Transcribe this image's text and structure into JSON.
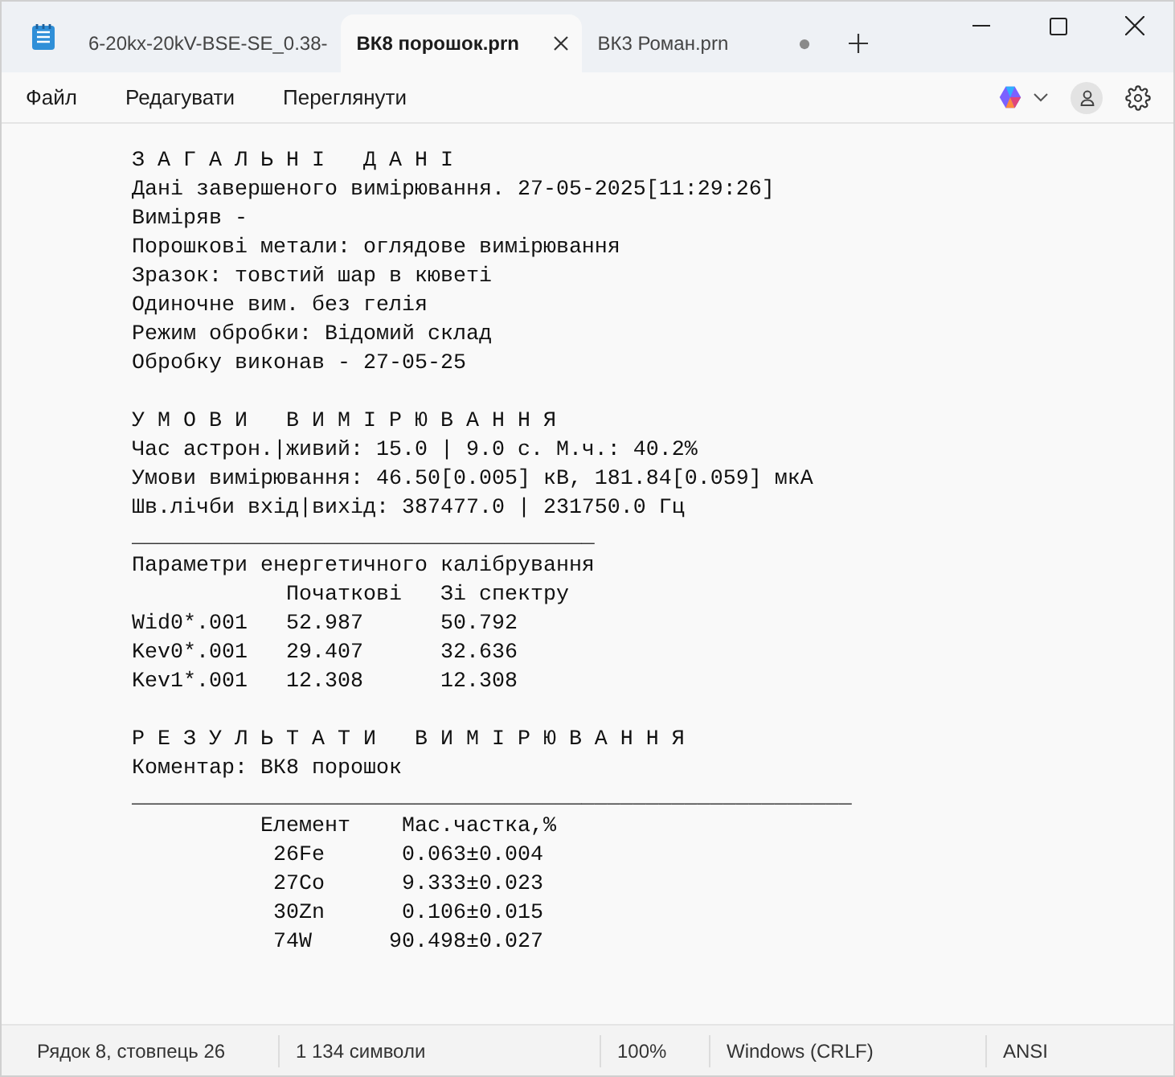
{
  "tabs": [
    {
      "label": "6-20kx-20kV-BSE-SE_0.38-",
      "selected": false,
      "modified": false
    },
    {
      "label": "ВК8 порошок.prn",
      "selected": true,
      "modified": false
    },
    {
      "label": "ВК3 Роман.prn",
      "selected": false,
      "modified": true
    }
  ],
  "menu": [
    "Файл",
    "Редагувати",
    "Переглянути"
  ],
  "document": {
    "blocks": [
      [
        "З А Г А Л Ь Н І   Д А Н І",
        "Дані завершеного вимірювання. 27-05-2025[11:29:26]",
        "Виміряв -",
        "Порошкові метали: оглядове вимірювання",
        "Зразок: товстий шар в кюветі",
        "Одиночне вим. без гелія",
        "Режим обробки: Відомий склад",
        "Обробку виконав - 27-05-25"
      ],
      [
        "У М О В И   В И М І Р Ю В А Н Н Я",
        "Час астрон.|живий: 15.0 | 9.0 с. М.ч.: 40.2%",
        "Умови вимірювання: 46.50[0.005] кВ, 181.84[0.059] мкА",
        "Шв.лічби вхід|вихід: 387477.0 | 231750.0 Гц",
        "____________________________________",
        "Параметри енергетичного калібрування",
        "            Початкові   Зі спектру",
        "Wid0*.001   52.987      50.792",
        "Kev0*.001   29.407      32.636",
        "Kev1*.001   12.308      12.308"
      ],
      [
        "Р Е З У Л Ь Т А Т И   В И М І Р Ю В А Н Н Я",
        "Коментар: ВК8 порошок",
        "________________________________________________________",
        "          Елемент    Мас.частка,%",
        "           26Fe      0.063±0.004",
        "           27Co      9.333±0.023",
        "           30Zn      0.106±0.015",
        "           74W      90.498±0.027"
      ]
    ]
  },
  "status_bar": [
    "Рядок 8, стовпець 26",
    "1 134 символи",
    "100%",
    "Windows (CRLF)",
    "ANSI"
  ]
}
